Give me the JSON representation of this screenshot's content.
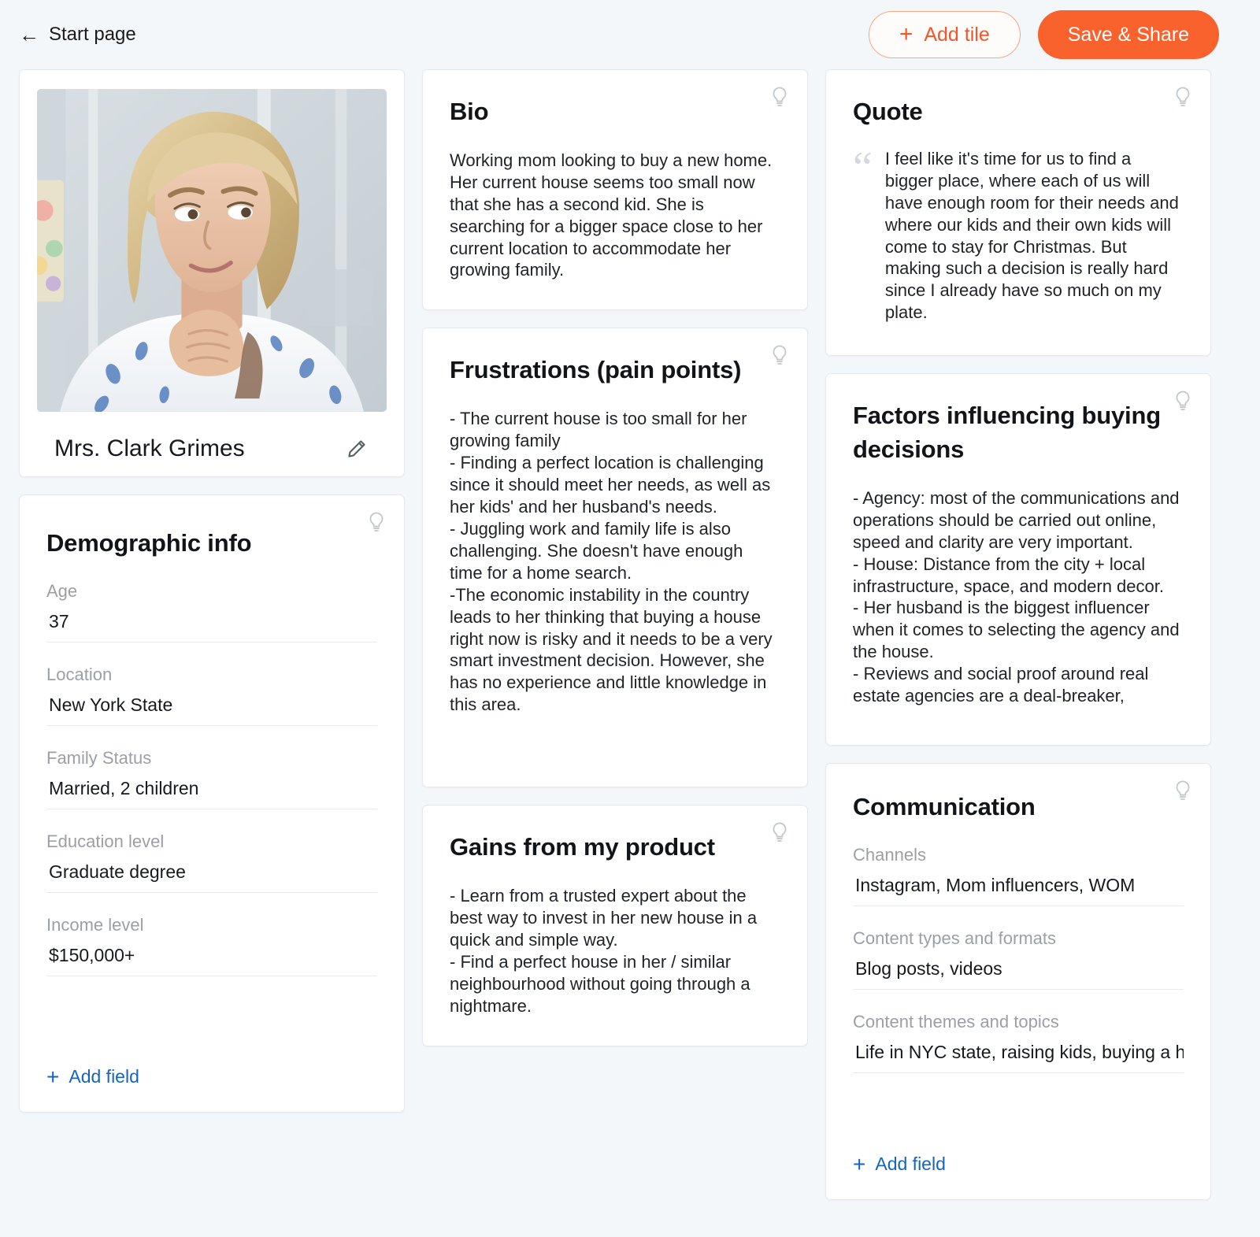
{
  "header": {
    "back_label": "Start page",
    "back_icon": "arrow-left-icon",
    "add_tile_label": "Add tile",
    "add_tile_plus": "+",
    "save_share_label": "Save & Share",
    "accent_color": "#f9612d",
    "accent_border_color": "#f5a883"
  },
  "persona": {
    "name": "Mrs. Clark Grimes",
    "edit_icon": "pencil-icon",
    "photo_alt": "portrait of a blonde woman resting chin on hands"
  },
  "demographic": {
    "title": "Demographic info",
    "bulb_icon": "lightbulb-icon",
    "fields": [
      {
        "label": "Age",
        "value": "37"
      },
      {
        "label": "Location",
        "value": "New York State"
      },
      {
        "label": "Family Status",
        "value": "Married, 2 children"
      },
      {
        "label": "Education level",
        "value": "Graduate degree"
      },
      {
        "label": "Income level",
        "value": "$150,000+"
      }
    ],
    "add_field_label": "Add field",
    "add_field_plus": "+",
    "link_color": "#1565c0"
  },
  "bio": {
    "title": "Bio",
    "bulb_icon": "lightbulb-icon",
    "text": "Working mom looking to buy a new home. Her current house seems too small now that she has a second kid. She is searching for a bigger space close to her current location to accommodate her growing family."
  },
  "frustrations": {
    "title": "Frustrations (pain points)",
    "bulb_icon": "lightbulb-icon",
    "text": "- The current house is too small for her growing family\n- Finding a perfect location is challenging since it should meet her needs, as well as her kids' and her husband's needs.\n- Juggling work and family life is also challenging. She doesn't have enough time for a home search.\n-The economic instability in the country leads to her thinking that buying a house right now is risky and it needs to be a very smart investment decision. However, she has no experience and little knowledge in this area."
  },
  "gains": {
    "title": "Gains from my product",
    "bulb_icon": "lightbulb-icon",
    "text": "- Learn from a trusted expert about the best way to invest in her new house in a quick and simple way.\n- Find a perfect house in her / similar neighbourhood without going through a nightmare."
  },
  "quote": {
    "title": "Quote",
    "bulb_icon": "lightbulb-icon",
    "quote_mark_icon": "quote-mark-icon",
    "quote_mark": "“",
    "text": "I feel like it's time for us to find a bigger place, where each of us will have enough room for their needs and where our kids and their own kids will come to stay for Christmas. But making such a decision is really hard since I already have so much on my plate."
  },
  "factors": {
    "title": "Factors influencing buying decisions",
    "bulb_icon": "lightbulb-icon",
    "text": "- Agency: most of the communications and operations should be carried out online, speed and clarity are very important.\n- House: Distance from the city + local infrastructure, space, and modern decor.\n- Her husband is the biggest influencer when it comes to selecting the agency and the house.\n- Reviews and social proof around real estate agencies are a deal-breaker,"
  },
  "communication": {
    "title": "Communication",
    "bulb_icon": "lightbulb-icon",
    "fields": [
      {
        "label": "Channels",
        "value": "Instagram, Mom influencers, WOM"
      },
      {
        "label": "Content types and formats",
        "value": "Blog posts, videos"
      },
      {
        "label": "Content themes and topics",
        "value": "Life in NYC state, raising kids, buying a hor"
      }
    ],
    "add_field_label": "Add field",
    "add_field_plus": "+"
  }
}
